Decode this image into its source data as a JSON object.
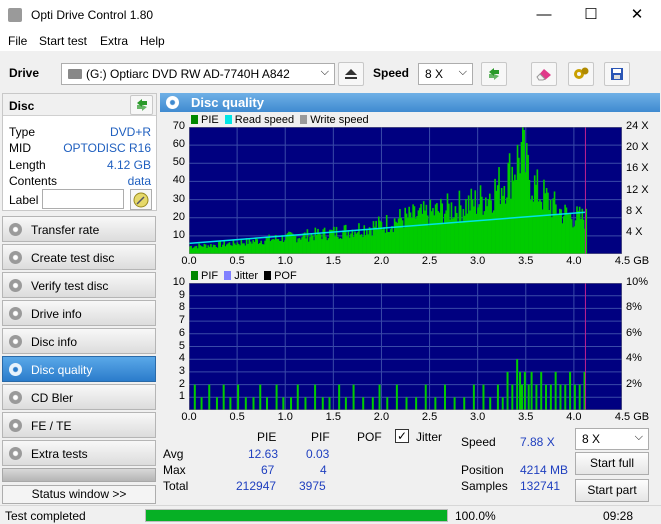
{
  "window": {
    "title": "Opti Drive Control 1.80",
    "minimize": "—",
    "maximize": "☐",
    "close": "✕"
  },
  "menu": [
    "File",
    "Start test",
    "Extra",
    "Help"
  ],
  "toolbar": {
    "drive_label": "Drive",
    "drive_value": "(G:)  Optiarc DVD RW AD-7740H A842",
    "speed_label": "Speed",
    "speed_value": "8 X"
  },
  "disc": {
    "header": "Disc",
    "props": [
      {
        "label": "Type",
        "value": "DVD+R"
      },
      {
        "label": "MID",
        "value": "OPTODISC R16"
      },
      {
        "label": "Length",
        "value": "4.12 GB"
      },
      {
        "label": "Contents",
        "value": "data"
      }
    ],
    "label_caption": "Label",
    "label_value": ""
  },
  "nav": [
    "Transfer rate",
    "Create test disc",
    "Verify test disc",
    "Drive info",
    "Disc info",
    "Disc quality",
    "CD Bler",
    "FE / TE",
    "Extra tests"
  ],
  "nav_active": "Disc quality",
  "status_window_button": "Status window >>",
  "panel_title": "Disc quality",
  "chart_data": [
    {
      "type": "area",
      "legend": [
        "PIE",
        "Read speed",
        "Write speed"
      ],
      "colors": {
        "PIE": "#00cc00",
        "Read speed": "#00e5e5",
        "Write speed": "#a0a0a0",
        "background": "#000080"
      },
      "x_ticks": [
        "0.0",
        "0.5",
        "1.0",
        "1.5",
        "2.0",
        "2.5",
        "3.0",
        "3.5",
        "4.0",
        "4.5 GB"
      ],
      "y_ticks_left": [
        "70",
        "60",
        "50",
        "40",
        "30",
        "20",
        "10"
      ],
      "y_ticks_right": [
        "24 X",
        "20 X",
        "16 X",
        "12 X",
        "8 X",
        "4 X"
      ],
      "xlim": [
        0,
        4.5
      ],
      "ylim_left": [
        0,
        70
      ],
      "ylim_right": [
        0,
        24
      ],
      "pie_envelope": {
        "x": [
          0.0,
          0.3,
          0.6,
          0.9,
          1.2,
          1.5,
          1.8,
          2.0,
          2.2,
          2.4,
          2.6,
          2.8,
          3.0,
          3.1,
          3.2,
          3.3,
          3.4,
          3.45,
          3.5,
          3.6,
          3.7,
          3.8,
          3.9,
          4.0,
          4.12
        ],
        "y": [
          5,
          6,
          8,
          10,
          12,
          14,
          17,
          19,
          23,
          25,
          28,
          31,
          34,
          38,
          43,
          50,
          60,
          67,
          55,
          42,
          36,
          30,
          26,
          24,
          23
        ]
      },
      "read_speed": {
        "x": [
          0.0,
          4.12
        ],
        "y": [
          2.0,
          7.9
        ]
      }
    },
    {
      "type": "bar",
      "legend": [
        "PIF",
        "Jitter",
        "POF"
      ],
      "colors": {
        "PIF": "#00cc00",
        "Jitter": "#8080ff",
        "POF": "#000000",
        "background": "#000080"
      },
      "x_ticks": [
        "0.0",
        "0.5",
        "1.0",
        "1.5",
        "2.0",
        "2.5",
        "3.0",
        "3.5",
        "4.0",
        "4.5 GB"
      ],
      "y_ticks_left": [
        "10",
        "9",
        "8",
        "7",
        "6",
        "5",
        "4",
        "3",
        "2",
        "1"
      ],
      "y_ticks_right": [
        "10%",
        "8%",
        "6%",
        "4%",
        "2%"
      ],
      "xlim": [
        0,
        4.5
      ],
      "ylim_left": [
        0,
        10
      ],
      "ylim_right": [
        0,
        10
      ],
      "pif_bars": {
        "x": [
          0.05,
          0.12,
          0.2,
          0.28,
          0.35,
          0.42,
          0.5,
          0.58,
          0.66,
          0.73,
          0.8,
          0.9,
          0.97,
          1.05,
          1.12,
          1.2,
          1.3,
          1.38,
          1.45,
          1.55,
          1.62,
          1.7,
          1.8,
          1.9,
          1.97,
          2.05,
          2.15,
          2.25,
          2.35,
          2.45,
          2.55,
          2.65,
          2.75,
          2.85,
          2.95,
          3.05,
          3.12,
          3.2,
          3.25,
          3.3,
          3.35,
          3.4,
          3.43,
          3.45,
          3.48,
          3.52,
          3.55,
          3.6,
          3.65,
          3.7,
          3.75,
          3.8,
          3.85,
          3.9,
          3.95,
          4.0,
          4.05,
          4.1
        ],
        "y": [
          2,
          1,
          2,
          1,
          2,
          1,
          2,
          1,
          1,
          2,
          1,
          2,
          1,
          1,
          2,
          1,
          2,
          1,
          1,
          2,
          1,
          2,
          1,
          1,
          2,
          1,
          2,
          1,
          1,
          2,
          1,
          2,
          1,
          1,
          2,
          2,
          1,
          2,
          1,
          3,
          2,
          4,
          3,
          2,
          3,
          2,
          3,
          2,
          3,
          2,
          2,
          3,
          2,
          2,
          3,
          2,
          2,
          3
        ]
      }
    }
  ],
  "stats": {
    "col_pie": "PIE",
    "col_pif": "PIF",
    "col_pof": "POF",
    "col_jitter": "Jitter",
    "avg_label": "Avg",
    "max_label": "Max",
    "total_label": "Total",
    "pie_avg": "12.63",
    "pie_max": "67",
    "pie_total": "212947",
    "pif_avg": "0.03",
    "pif_max": "4",
    "pif_total": "3975",
    "jitter_checked": true
  },
  "results": {
    "speed_label": "Speed",
    "speed_value": "7.88 X",
    "position_label": "Position",
    "position_value": "4214 MB",
    "samples_label": "Samples",
    "samples_value": "132741",
    "speed_combo": "8 X",
    "start_full": "Start full",
    "start_part": "Start part"
  },
  "statusbar": {
    "text": "Test completed",
    "progress": 100.0,
    "progress_text": "100.0%",
    "time": "09:28"
  }
}
